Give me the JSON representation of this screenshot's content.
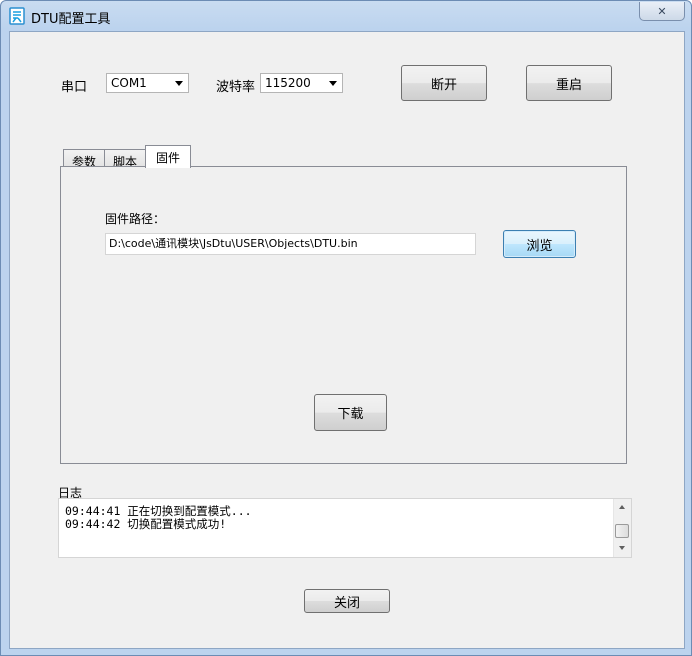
{
  "window": {
    "title": "DTU配置工具",
    "close_glyph": "✕"
  },
  "connection": {
    "port_label": "串口",
    "port_value": "COM1",
    "baud_label": "波特率",
    "baud_value": "115200",
    "disconnect_label": "断开",
    "restart_label": "重启"
  },
  "tabs": [
    {
      "label": "参数",
      "active": false
    },
    {
      "label": "脚本",
      "active": false
    },
    {
      "label": "固件",
      "active": true
    }
  ],
  "firmware": {
    "path_label": "固件路径：",
    "path_value": "D:\\code\\通讯模块\\JsDtu\\USER\\Objects\\DTU.bin",
    "browse_label": "浏览",
    "download_label": "下载"
  },
  "log": {
    "label": "日志",
    "lines": [
      "09:44:41  正在切换到配置模式...",
      "09:44:42  切换配置模式成功!"
    ]
  },
  "footer": {
    "close_label": "关闭"
  },
  "colors": {
    "frame": "#bcd3ee",
    "client": "#f0f0f0",
    "focus_border": "#3c7fb1"
  },
  "icons": {
    "app": "app-icon",
    "close": "close-icon",
    "dropdown": "chevron-down-icon"
  }
}
